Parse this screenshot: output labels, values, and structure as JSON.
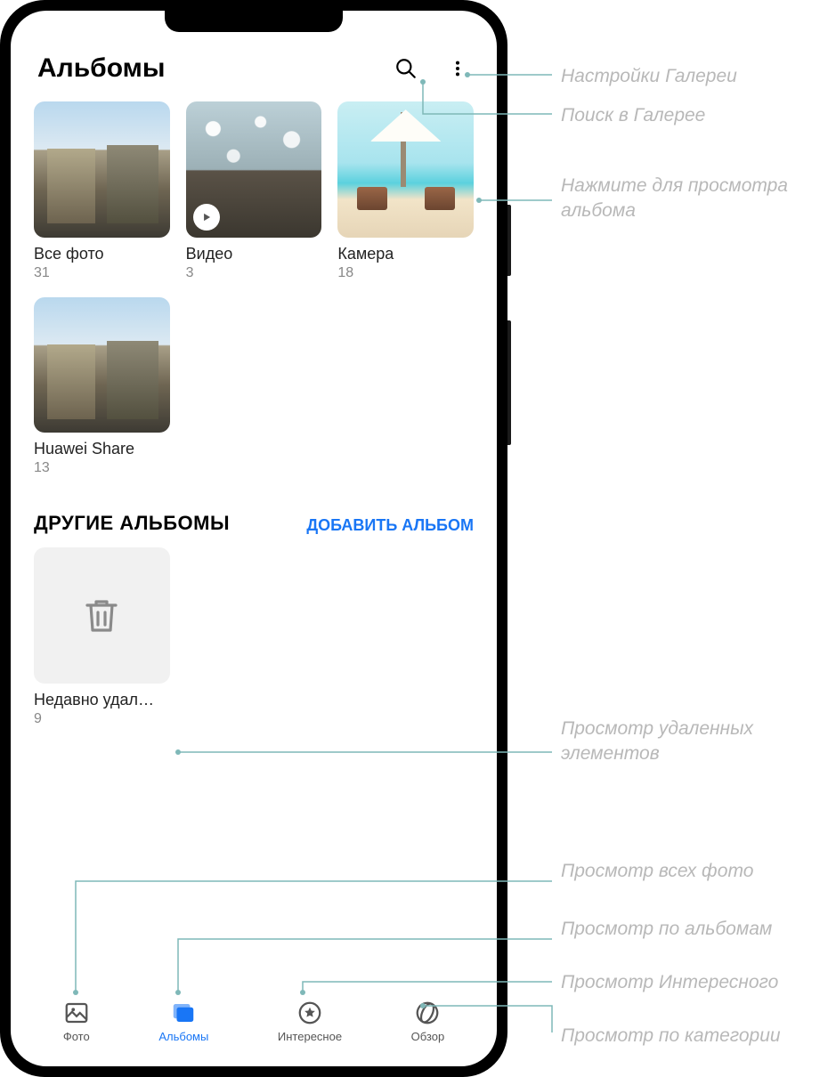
{
  "header": {
    "title": "Альбомы"
  },
  "albums": [
    {
      "name": "Все фото",
      "count": "31",
      "thumb": "street"
    },
    {
      "name": "Видео",
      "count": "3",
      "thumb": "bokeh",
      "hasVideo": true
    },
    {
      "name": "Камера",
      "count": "18",
      "thumb": "beach"
    },
    {
      "name": "Huawei Share",
      "count": "13",
      "thumb": "street"
    }
  ],
  "otherSection": {
    "title": "ДРУГИЕ АЛЬБОМЫ",
    "addLabel": "ДОБАВИТЬ АЛЬБОМ",
    "deleted": {
      "name": "Недавно удал…",
      "count": "9"
    }
  },
  "tabs": [
    {
      "label": "Фото",
      "icon": "photo"
    },
    {
      "label": "Альбомы",
      "icon": "albums",
      "active": true
    },
    {
      "label": "Интересное",
      "icon": "star"
    },
    {
      "label": "Обзор",
      "icon": "browse"
    }
  ],
  "callouts": {
    "settings": "Настройки Галереи",
    "search": "Поиск в Галерее",
    "viewAlbum": "Нажмите для просмотра альбома",
    "viewDeleted": "Просмотр удаленных элементов",
    "viewPhotos": "Просмотр всех фото",
    "viewAlbums": "Просмотр по альбомам",
    "viewDiscover": "Просмотр Интересного",
    "viewCategory": "Просмотр по категории"
  }
}
